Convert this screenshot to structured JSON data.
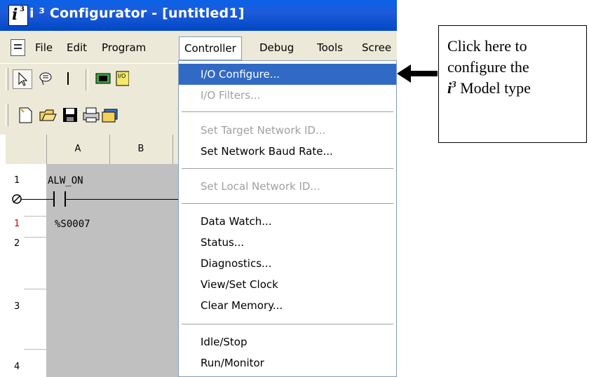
{
  "window": {
    "logo_text": "i³",
    "title": "i ³ Configurator - [untitled1]"
  },
  "menubar": {
    "items": [
      "File",
      "Edit",
      "Program",
      "Controller",
      "Debug",
      "Tools",
      "Scree"
    ]
  },
  "toolbar": {
    "icons": [
      "arrow-pointer-icon",
      "lasso-icon",
      "vertical-line-icon",
      "contact-icon",
      "io-icon",
      "new-file-icon",
      "open-folder-icon",
      "save-icon",
      "print-icon",
      "window-icon"
    ]
  },
  "ladder": {
    "columns": [
      "A",
      "B"
    ],
    "rows": [
      {
        "num": "1",
        "label": "ALW_ON",
        "address": "%S0007",
        "sub": "1"
      },
      {
        "num": "2"
      },
      {
        "num": "3"
      },
      {
        "num": "4"
      }
    ]
  },
  "controller_menu": {
    "items": [
      {
        "label": "I/O Configure...",
        "state": "highlighted"
      },
      {
        "label": "I/O Filters...",
        "state": "disabled"
      },
      {
        "sep": true
      },
      {
        "label": "Set Target Network ID...",
        "state": "disabled"
      },
      {
        "label": "Set Network Baud Rate...",
        "state": "normal"
      },
      {
        "sep": true
      },
      {
        "label": "Set Local Network ID...",
        "state": "disabled"
      },
      {
        "sep": true
      },
      {
        "label": "Data Watch...",
        "state": "normal"
      },
      {
        "label": "Status...",
        "state": "normal"
      },
      {
        "label": "Diagnostics...",
        "state": "normal"
      },
      {
        "label": "View/Set Clock",
        "state": "normal"
      },
      {
        "label": "Clear Memory...",
        "state": "normal"
      },
      {
        "sep": true
      },
      {
        "label": "Idle/Stop",
        "state": "normal"
      },
      {
        "label": "Run/Monitor",
        "state": "normal"
      }
    ]
  },
  "callout": {
    "line1": "Click here to",
    "line2": "configure the",
    "i_text": "i",
    "sup_text": "3",
    "line3_rest": " Model type"
  },
  "colors": {
    "titlebar": "#0a5fe0",
    "menu_highlight": "#316ac5",
    "disabled_text": "#a0a0a0",
    "rung_area": "#c0c0c0"
  }
}
